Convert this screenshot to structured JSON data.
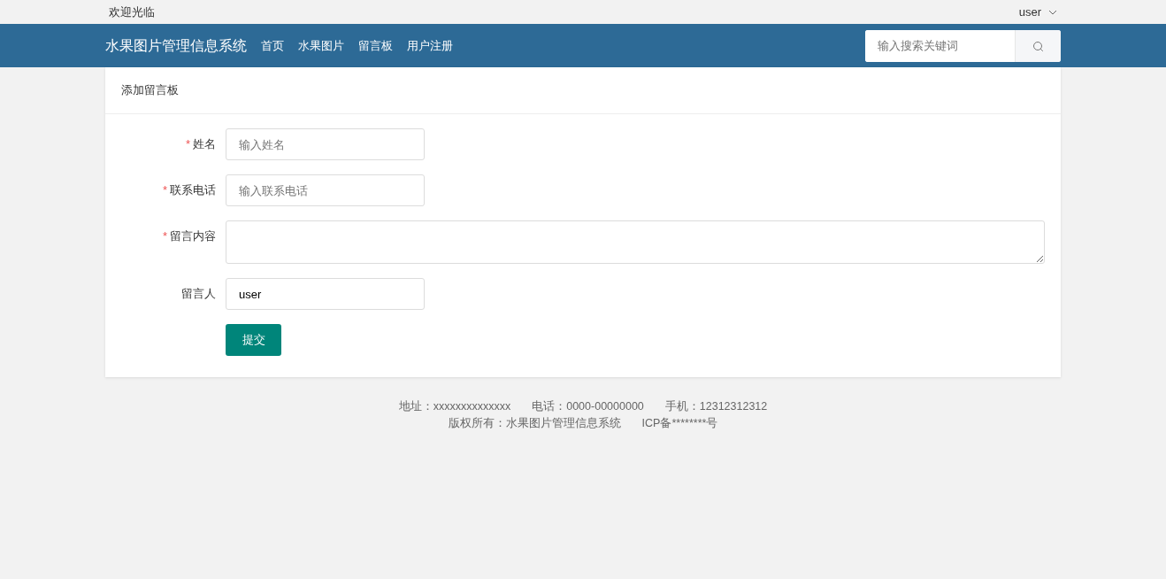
{
  "top_bar": {
    "welcome": "欢迎光临",
    "user": "user"
  },
  "navbar": {
    "brand": "水果图片管理信息系统",
    "links": [
      {
        "label": "首页"
      },
      {
        "label": "水果图片"
      },
      {
        "label": "留言板"
      },
      {
        "label": "用户注册"
      }
    ],
    "search": {
      "placeholder": "输入搜索关键词"
    }
  },
  "card": {
    "title": "添加留言板",
    "fields": [
      {
        "kind": "input",
        "required_mark": "*",
        "label": "姓名",
        "placeholder": "输入姓名"
      },
      {
        "kind": "input",
        "required_mark": "*",
        "label": "联系电话",
        "placeholder": "输入联系电话"
      },
      {
        "kind": "textarea",
        "required_mark": "*",
        "label": "留言内容"
      },
      {
        "kind": "input",
        "label": "留言人",
        "value": "user"
      }
    ],
    "submit": "提交"
  },
  "footer": {
    "lines": [
      [
        "地址：xxxxxxxxxxxxxx",
        "电话：0000-00000000",
        "手机：12312312312"
      ],
      [
        "版权所有：水果图片管理信息系统",
        "ICP备********号"
      ]
    ]
  }
}
